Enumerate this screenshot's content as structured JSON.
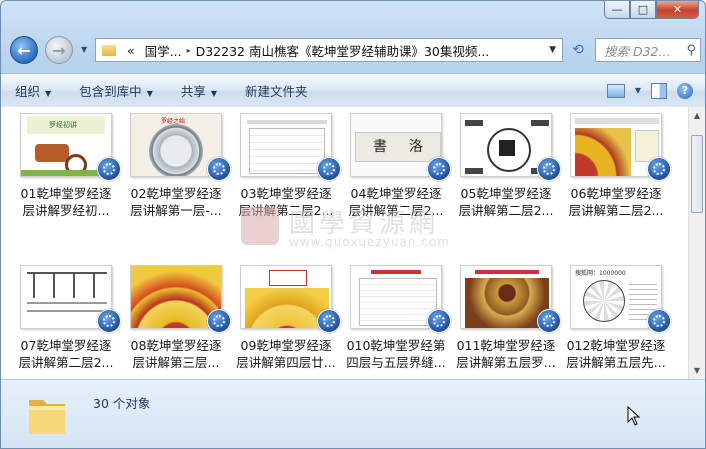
{
  "window": {
    "min": "—",
    "max": "□",
    "close": "✕"
  },
  "address": {
    "overflow": "«",
    "segments": [
      "国学...",
      "D32232 南山樵客《乾坤堂罗经辅助课》30集视频..."
    ],
    "sep": "▸",
    "drop": "▼"
  },
  "search": {
    "placeholder": "搜索 D32..."
  },
  "toolbar": {
    "organize": "组织",
    "include_library": "包含到库中",
    "share": "共享",
    "new_folder": "新建文件夹"
  },
  "items": [
    {
      "line1": "01乾坤堂罗经逐",
      "line2": "层讲解罗经初..."
    },
    {
      "line1": "02乾坤堂罗经逐",
      "line2": "层讲解第一层-..."
    },
    {
      "line1": "03乾坤堂罗经逐",
      "line2": "层讲解第二层2..."
    },
    {
      "line1": "04乾坤堂罗经逐",
      "line2": "层讲解第二层2..."
    },
    {
      "line1": "05乾坤堂罗经逐",
      "line2": "层讲解第二层2..."
    },
    {
      "line1": "06乾坤堂罗经逐",
      "line2": "层讲解第二层2..."
    },
    {
      "line1": "07乾坤堂罗经逐",
      "line2": "层讲解第二层2..."
    },
    {
      "line1": "08乾坤堂罗经逐",
      "line2": "层讲解第三层..."
    },
    {
      "line1": "09乾坤堂罗经逐",
      "line2": "层讲解第四层廿..."
    },
    {
      "line1": "010乾坤堂罗经第",
      "line2": "四层与五层界缝..."
    },
    {
      "line1": "011乾坤堂罗经逐",
      "line2": "层讲解第五层罗..."
    },
    {
      "line1": "012乾坤堂罗经逐",
      "line2": "层讲解第五层先..."
    }
  ],
  "thumb_text": {
    "t1": "罗经初讲",
    "t2": "罗经之始",
    "t4a": "書",
    "t4b": "洛",
    "t12": "搜狐网：1000000"
  },
  "watermark": {
    "text": "國學資源網",
    "url": "www.guoxuezyuan.com"
  },
  "status": {
    "count": "30 个对象"
  }
}
